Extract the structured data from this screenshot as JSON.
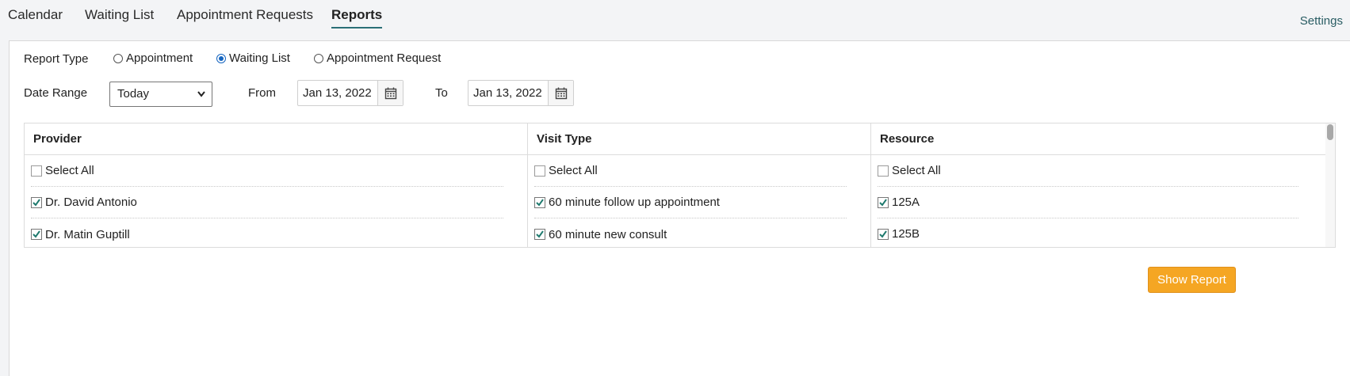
{
  "nav": {
    "tabs": [
      {
        "label": "Calendar",
        "active": false
      },
      {
        "label": "Waiting List",
        "active": false
      },
      {
        "label": "Appointment Requests",
        "active": false
      },
      {
        "label": "Reports",
        "active": true
      }
    ],
    "settings_label": "Settings"
  },
  "form": {
    "report_type_label": "Report Type",
    "report_type_options": [
      {
        "label": "Appointment",
        "selected": false
      },
      {
        "label": "Waiting List",
        "selected": true
      },
      {
        "label": "Appointment Request",
        "selected": false
      }
    ],
    "date_range_label": "Date Range",
    "date_range_value": "Today",
    "from_label": "From",
    "from_value": "Jan 13, 2022",
    "to_label": "To",
    "to_value": "Jan 13, 2022"
  },
  "table": {
    "columns": [
      {
        "header": "Provider",
        "rows": [
          {
            "label": "Select All",
            "checked": false
          },
          {
            "label": "Dr. David Antonio",
            "checked": true
          },
          {
            "label": "Dr. Matin Guptill",
            "checked": true
          }
        ]
      },
      {
        "header": "Visit Type",
        "rows": [
          {
            "label": "Select All",
            "checked": false
          },
          {
            "label": "60 minute follow up appointment",
            "checked": true
          },
          {
            "label": "60 minute new consult",
            "checked": true
          }
        ]
      },
      {
        "header": "Resource",
        "rows": [
          {
            "label": "Select All",
            "checked": false
          },
          {
            "label": "125A",
            "checked": true
          },
          {
            "label": "125B",
            "checked": true
          }
        ]
      }
    ]
  },
  "actions": {
    "show_report_label": "Show Report"
  },
  "colors": {
    "accent": "#2a6f76",
    "button": "#f5a623",
    "radio_selected": "#1565c0"
  },
  "icons": {
    "calendar": "calendar-icon",
    "chevron": "chevron-down-icon",
    "check": "check-icon"
  }
}
